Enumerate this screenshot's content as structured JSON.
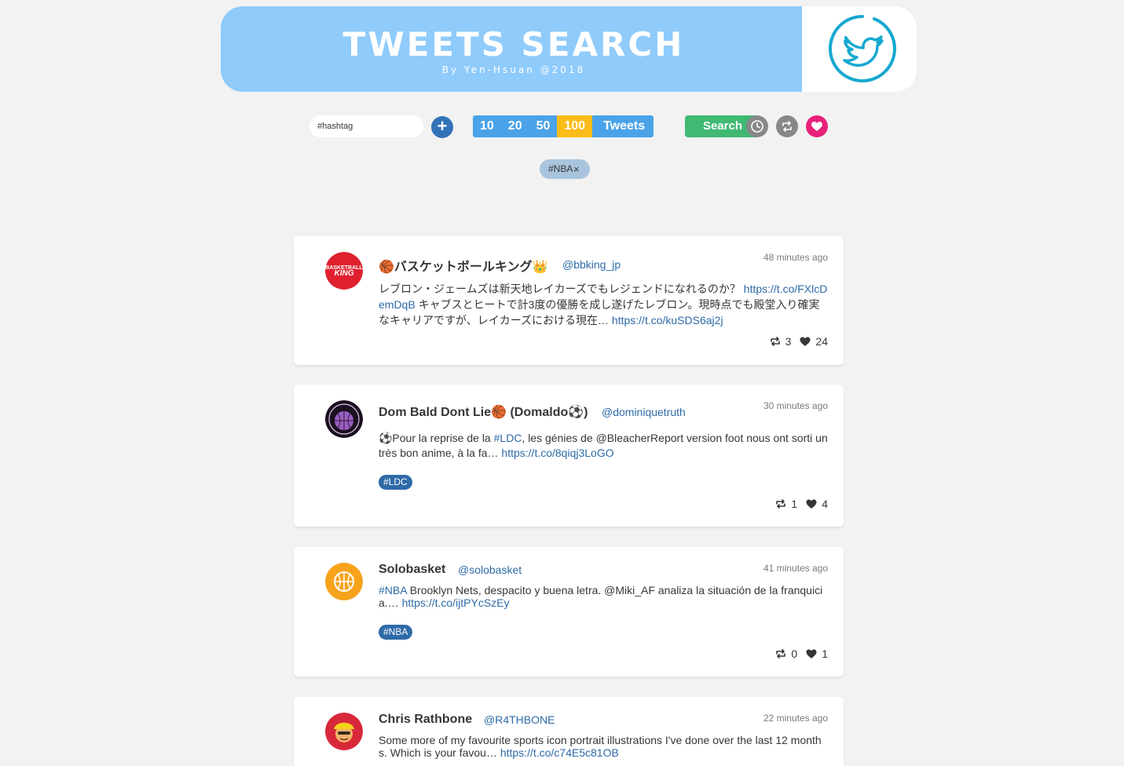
{
  "header": {
    "title": "TWEETS SEARCH",
    "subtitle": "By Yen-Hsuan @2018",
    "logo_icon": "twitter-bird-icon",
    "banner_color": "#8fcbfb",
    "logo_color": "#16a8d0"
  },
  "controls": {
    "hashtag_placeholder": "#hashtag",
    "add_label": "+",
    "counts": [
      "10",
      "20",
      "50",
      "100"
    ],
    "active_count": "100",
    "count_unit": "Tweets",
    "search_label": "Search",
    "icons": [
      "clock-icon",
      "retweet-icon",
      "heart-icon"
    ]
  },
  "tags": [
    {
      "label": "#NBA",
      "remove": "×"
    }
  ],
  "tweets": [
    {
      "name": "🏀バスケットボールキング👑",
      "handle": "@bbking_jp",
      "time": "48 minutes ago",
      "text_parts": [
        {
          "t": "レブロン・ジェームズは新天地レイカーズでもレジェンドになれるのか？ ",
          "link": false
        },
        {
          "t": "https://t.co/FXlcDemDqB",
          "link": true
        },
        {
          "t": " キャブスとヒートで計3度の優勝を成し遂げたレブロン。現時点でも殿堂入り確実なキャリアですが、レイカーズにおける現在… ",
          "link": false
        },
        {
          "t": "https://t.co/kuSDS6aj2j",
          "link": true
        }
      ],
      "hashtags": [],
      "retweets": "3",
      "likes": "24",
      "avatar_color": "#e0202e"
    },
    {
      "name": "Dom Bald Dont Lie🏀 (Domaldo⚽)",
      "handle": "@dominiquetruth",
      "time": "30 minutes ago",
      "text_parts": [
        {
          "t": "⚽Pour la reprise de la ",
          "link": false
        },
        {
          "t": "#LDC",
          "link": true
        },
        {
          "t": ", les génies de @BleacherReport version foot nous ont sorti un très bon anime, à la fa… ",
          "link": false
        },
        {
          "t": "https://t.co/8qiqj3LoGO",
          "link": true
        }
      ],
      "hashtags": [
        "#LDC"
      ],
      "retweets": "1",
      "likes": "4",
      "avatar_color": "#2a1a3a"
    },
    {
      "name": "Solobasket",
      "handle": "@solobasket",
      "time": "41 minutes ago",
      "text_parts": [
        {
          "t": "#NBA",
          "link": true
        },
        {
          "t": " Brooklyn Nets, despacito y buena letra. @Miki_AF analiza la situación de la franquicia.… ",
          "link": false
        },
        {
          "t": "https://t.co/ijtPYcSzEy",
          "link": true
        }
      ],
      "hashtags": [
        "#NBA"
      ],
      "retweets": "0",
      "likes": "1",
      "avatar_color": "#f7a21b"
    },
    {
      "name": "Chris Rathbone",
      "handle": "@R4THBONE",
      "time": "22 minutes ago",
      "text_parts": [
        {
          "t": "Some more of my favourite sports icon portrait illustrations I've done over the last 12 months. Which is your favou… ",
          "link": false
        },
        {
          "t": "https://t.co/c74E5c81OB",
          "link": true
        }
      ],
      "hashtags": [],
      "retweets": "",
      "likes": "",
      "avatar_color": "#d8283a"
    }
  ]
}
